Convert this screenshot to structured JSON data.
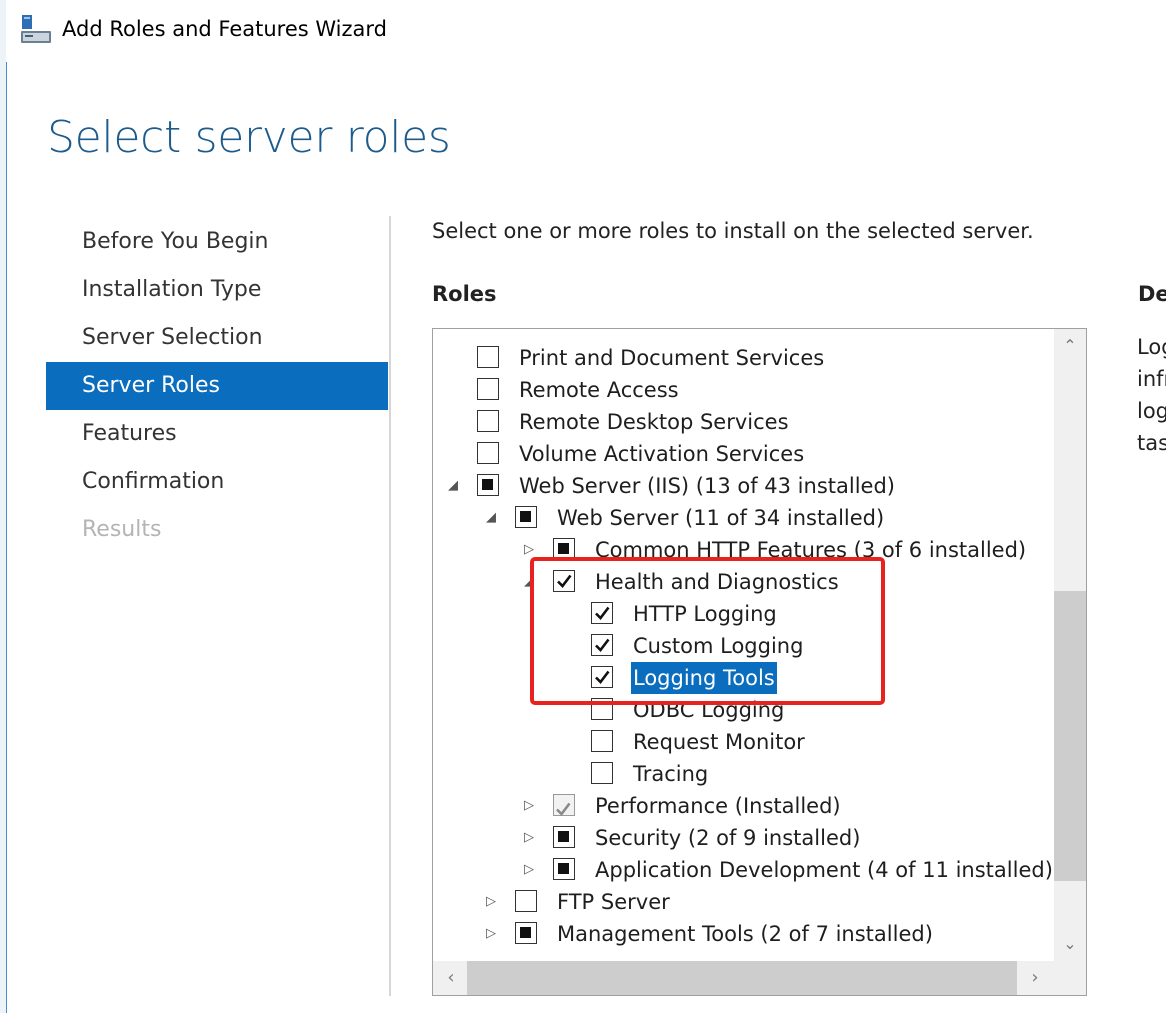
{
  "window": {
    "title": "Add Roles and Features Wizard",
    "icon": "server-manager-icon"
  },
  "page_title": "Select server roles",
  "nav": {
    "items": [
      {
        "label": "Before You Begin",
        "state": "normal"
      },
      {
        "label": "Installation Type",
        "state": "normal"
      },
      {
        "label": "Server Selection",
        "state": "normal"
      },
      {
        "label": "Server Roles",
        "state": "active"
      },
      {
        "label": "Features",
        "state": "normal"
      },
      {
        "label": "Confirmation",
        "state": "normal"
      },
      {
        "label": "Results",
        "state": "disabled"
      }
    ]
  },
  "content": {
    "instruction": "Select one or more roles to install on the selected server.",
    "roles_label": "Roles",
    "description_label": "De",
    "description_text": "Log\ninfr\nlog\ntas"
  },
  "tree": {
    "rows": [
      {
        "label": "Print and Document Services",
        "level": 0,
        "expander": "none",
        "check": "unchecked"
      },
      {
        "label": "Remote Access",
        "level": 0,
        "expander": "none",
        "check": "unchecked"
      },
      {
        "label": "Remote Desktop Services",
        "level": 0,
        "expander": "none",
        "check": "unchecked"
      },
      {
        "label": "Volume Activation Services",
        "level": 0,
        "expander": "none",
        "check": "unchecked"
      },
      {
        "label": "Web Server (IIS) (13 of 43 installed)",
        "level": 0,
        "expander": "expanded",
        "check": "partial"
      },
      {
        "label": "Web Server (11 of 34 installed)",
        "level": 1,
        "expander": "expanded",
        "check": "partial"
      },
      {
        "label": "Common HTTP Features (3 of 6 installed)",
        "level": 2,
        "expander": "collapsed",
        "check": "partial"
      },
      {
        "label": "Health and Diagnostics",
        "level": 2,
        "expander": "expanded",
        "check": "checked"
      },
      {
        "label": "HTTP Logging",
        "level": 3,
        "expander": "none",
        "check": "checked"
      },
      {
        "label": "Custom Logging",
        "level": 3,
        "expander": "none",
        "check": "checked"
      },
      {
        "label": "Logging Tools",
        "level": 3,
        "expander": "none",
        "check": "checked",
        "selected": true
      },
      {
        "label": "ODBC Logging",
        "level": 3,
        "expander": "none",
        "check": "unchecked"
      },
      {
        "label": "Request Monitor",
        "level": 3,
        "expander": "none",
        "check": "unchecked"
      },
      {
        "label": "Tracing",
        "level": 3,
        "expander": "none",
        "check": "unchecked"
      },
      {
        "label": "Performance (Installed)",
        "level": 2,
        "expander": "collapsed",
        "check": "installed"
      },
      {
        "label": "Security (2 of 9 installed)",
        "level": 2,
        "expander": "collapsed",
        "check": "partial"
      },
      {
        "label": "Application Development (4 of 11 installed)",
        "level": 2,
        "expander": "collapsed",
        "check": "partial"
      },
      {
        "label": "FTP Server",
        "level": 1,
        "expander": "collapsed",
        "check": "unchecked"
      },
      {
        "label": "Management Tools (2 of 7 installed)",
        "level": 1,
        "expander": "collapsed",
        "check": "partial"
      }
    ]
  },
  "colors": {
    "accent": "#0a6dbe",
    "title": "#1d5b8c",
    "annotation": "#e8231f"
  }
}
